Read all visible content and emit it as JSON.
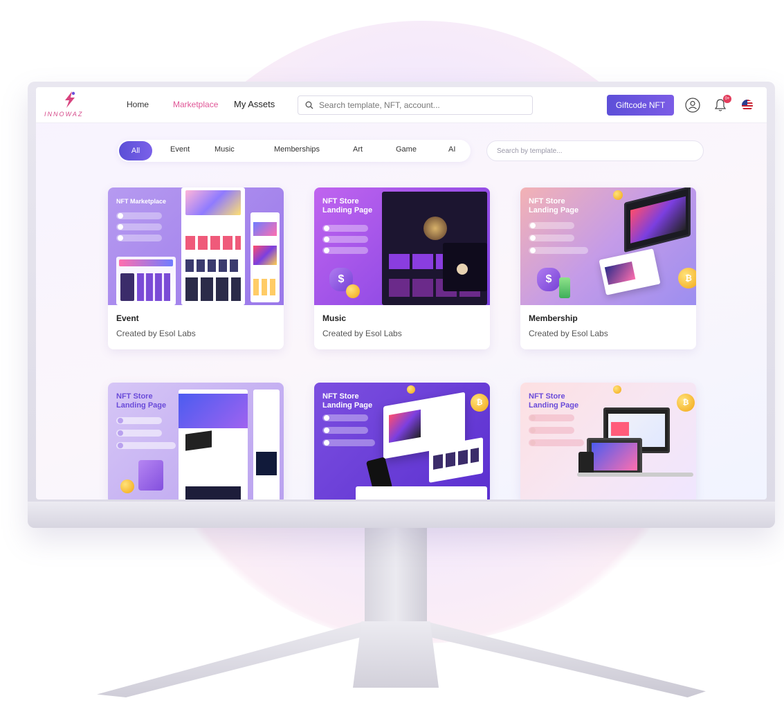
{
  "brand": {
    "logo_text": "INNOWAZ"
  },
  "nav": {
    "links": [
      {
        "label": "Home"
      },
      {
        "label": "Marketplace"
      },
      {
        "label": "My Assets"
      }
    ],
    "search_placeholder": "Search template, NFT, account...",
    "giftcode_label": "Giftcode NFT",
    "notification_count": "0+",
    "icons": [
      "user-icon",
      "bell-icon",
      "us-flag-icon"
    ]
  },
  "filters": {
    "tabs": [
      "All",
      "Event",
      "Music",
      "Memberships",
      "Art",
      "Game",
      "AI"
    ],
    "active_tab": "All",
    "search_placeholder": "Search by template..."
  },
  "cards": [
    {
      "title": "Event",
      "creator": "Created by Esol Labs",
      "thumb_heading": "NFT Marketplace"
    },
    {
      "title": "Music",
      "creator": "Created by Esol Labs",
      "thumb_heading": "NFT Store Landing Page"
    },
    {
      "title": "Membership",
      "creator": "Created by Esol Labs",
      "thumb_heading": "NFT Store Landing Page"
    },
    {
      "title": "",
      "creator": "",
      "thumb_heading": "NFT Store Landing Page"
    },
    {
      "title": "",
      "creator": "",
      "thumb_heading": "NFT Store Landing Page"
    },
    {
      "title": "",
      "creator": "",
      "thumb_heading": "NFT Store Landing Page"
    }
  ],
  "colors": {
    "accent": "#6a55e0",
    "brand_pink": "#e05596"
  }
}
